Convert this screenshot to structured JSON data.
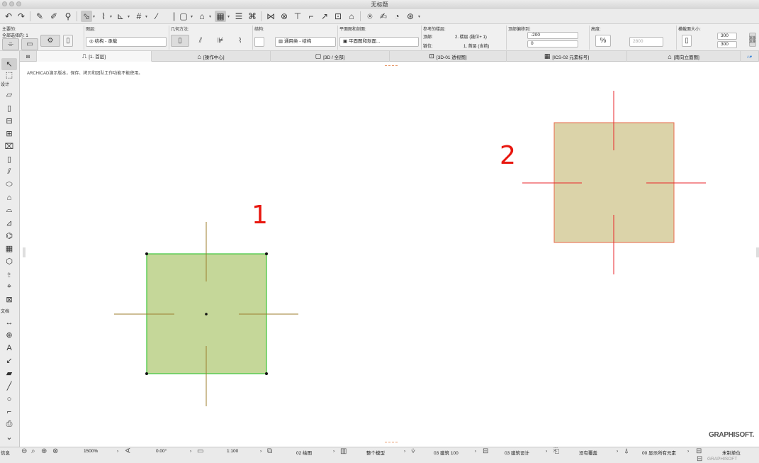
{
  "window": {
    "title": "无标题"
  },
  "toolbar": {
    "icons": [
      "undo-icon",
      "redo-icon",
      "eyedropper-icon",
      "syringe-icon",
      "wand-icon",
      "arrow-select-icon",
      "marquee-icon",
      "grid-icon",
      "snap-icon",
      "trace-icon",
      "dimension-icon",
      "guide-icon",
      "intersect-icon",
      "trim-icon",
      "offset-icon",
      "fillet-icon",
      "chamfer-icon",
      "curve-icon",
      "magic-icon",
      "view-icon"
    ]
  },
  "infobox": {
    "main_label": "主要的:",
    "selection_label": "全部选择的: 1",
    "layer_label": "图层:",
    "layer_value": "结构 - 承载",
    "geometry_label": "几何方法:",
    "structure_label": "结构:",
    "structure_value": "通用类 - 结构",
    "floorplan_label": "平面图和剖面:",
    "floorplan_value": "平面图和剖面...",
    "story_label": "参考的楼层:",
    "top_label": "顶部:",
    "top_value": "2. 楼层 (链位+ 1)",
    "bottom_label": "链位:",
    "bottom_value": "1. 首层 (当前)",
    "offset_label": "顶部偏移到:",
    "offset_top": "-200",
    "offset_bottom": "0",
    "height_label": "高度:",
    "height_value": "2800",
    "percent_symbol": "%",
    "size_label": "横截面大小:",
    "size_w": "300",
    "size_h": "300"
  },
  "tabs": [
    {
      "label": "[1. 首层]",
      "icon": "floorplan-icon",
      "active": true
    },
    {
      "label": "[操作中心]",
      "icon": "action-center-icon",
      "active": false
    },
    {
      "label": "[3D / 全部]",
      "icon": "3d-icon",
      "active": false
    },
    {
      "label": "[3D-01 透视图]",
      "icon": "perspective-icon",
      "active": false
    },
    {
      "label": "[ICS-02 元素标号]",
      "icon": "schedule-icon",
      "active": false
    },
    {
      "label": "[南向立面图]",
      "icon": "elevation-icon",
      "active": false
    }
  ],
  "toolbox": {
    "design_label": "设计",
    "document_label": "文档"
  },
  "canvas": {
    "notice": "ARCHICAD演示版本，保存、拷贝和团队工作功能不能使用。",
    "label_1": "1",
    "label_2": "2",
    "colors": {
      "column1_fill": "#c5d799",
      "column1_stroke": "#3cc43a",
      "column2_fill": "#dbd3a9",
      "column2_stroke": "#e86a4a",
      "axis1": "#9c7c2e",
      "axis2": "#e8262b",
      "label": "#e8170f"
    }
  },
  "brand": "GRAPHISOFT.",
  "statusbar": {
    "left_label": "信息",
    "zoom": "1500%",
    "angle": "0.00°",
    "scale": "1:100",
    "layer_combo": "02 绘图",
    "model_view": "整个模型",
    "pen_set": "03 建筑 100",
    "mvo": "03 建筑设计",
    "override": "没有覆盖",
    "renovation": "00 显示所有元素",
    "units": "米制单位",
    "brand_small": "GRAPHISOFT"
  }
}
